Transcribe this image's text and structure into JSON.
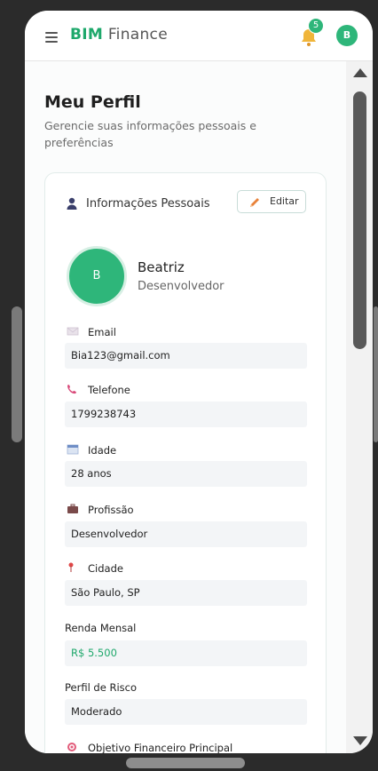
{
  "header": {
    "brand_strong": "BIM",
    "brand_rest": "Finance",
    "notification_count": "5",
    "user_initial": "B"
  },
  "page": {
    "title": "Meu Perfil",
    "subtitle": "Gerencie suas informações pessoais e preferências"
  },
  "personal_info": {
    "section_title": "Informações Pessoais",
    "edit_label": "Editar",
    "avatar_initial": "B",
    "name": "Beatriz",
    "role": "Desenvolvedor",
    "fields": {
      "email_label": "Email",
      "email_value": "Bia123@gmail.com",
      "phone_label": "Telefone",
      "phone_value": "1799238743",
      "age_label": "Idade",
      "age_value": "28 anos",
      "profession_label": "Profissão",
      "profession_value": "Desenvolvedor",
      "city_label": "Cidade",
      "city_value": "São Paulo, SP",
      "income_label": "Renda Mensal",
      "income_value": "R$ 5.500",
      "risk_label": "Perfil de Risco",
      "risk_value": "Moderado",
      "goal_label": "Objetivo Financeiro Principal"
    }
  },
  "colors": {
    "accent": "#2eb67a",
    "accent_dark": "#1ea86b"
  }
}
